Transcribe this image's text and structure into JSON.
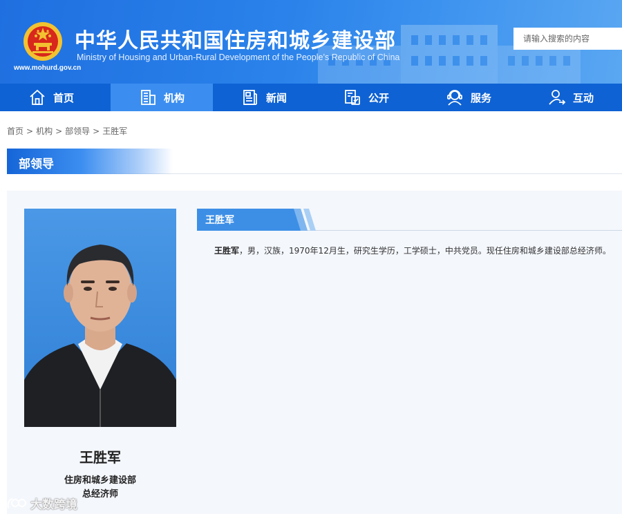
{
  "header": {
    "title": "中华人民共和国住房和城乡建设部",
    "subtitle": "Ministry of Housing and Urban-Rural Development of the People’s Republic of China",
    "domain": "www.mohurd.gov.cn",
    "search_placeholder": "请输入搜索的内容",
    "search_value": ""
  },
  "nav": {
    "items": [
      {
        "label": "首页",
        "icon": "home-icon"
      },
      {
        "label": "机构",
        "icon": "building-icon",
        "active": true
      },
      {
        "label": "新闻",
        "icon": "news-icon"
      },
      {
        "label": "公开",
        "icon": "disclosure-icon"
      },
      {
        "label": "服务",
        "icon": "service-icon"
      },
      {
        "label": "互动",
        "icon": "interaction-icon"
      }
    ]
  },
  "breadcrumb": {
    "items": [
      "首页",
      "机构",
      "部领导",
      "王胜军"
    ],
    "separator": ">"
  },
  "section": {
    "title": "部领导"
  },
  "profile": {
    "name": "王胜军",
    "organization": "住房和城乡建设部",
    "position": "总经济师",
    "bio_name": "王胜军",
    "bio_text": "，男，汉族，1970年12月生，研究生学历，工学硕士，中共党员。现任住房和城乡建设部总经济师。"
  },
  "watermark": {
    "text": "大数跨境"
  },
  "colors": {
    "brand_blue": "#0e62d4",
    "nav_active": "#3b8ef0",
    "panel_bg": "#f4f7fc",
    "photo_bg": "#3a8be0"
  }
}
